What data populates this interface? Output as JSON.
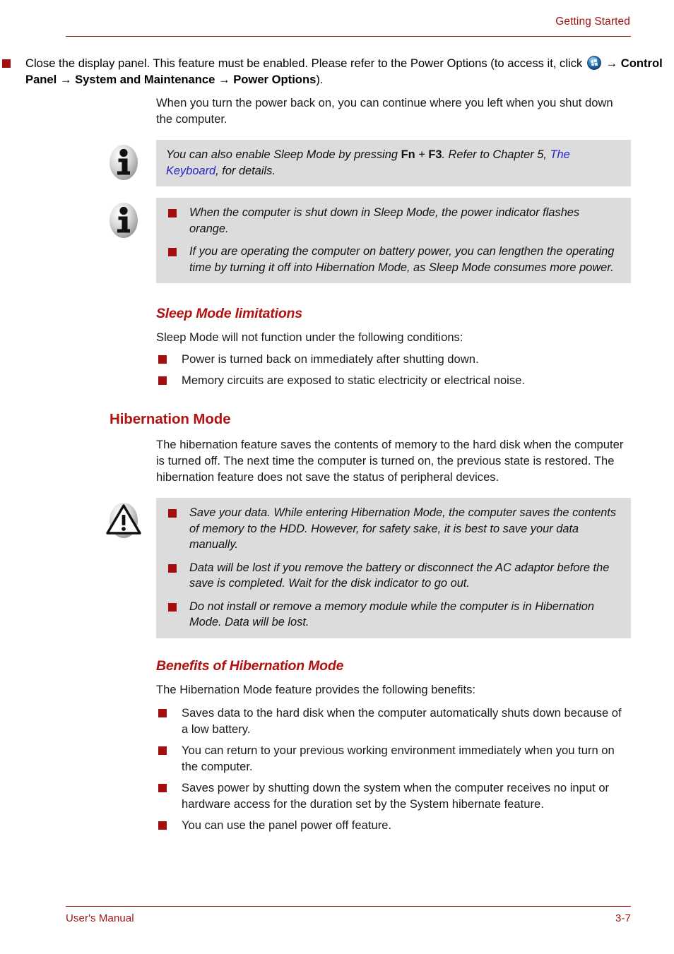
{
  "header": {
    "title": "Getting Started"
  },
  "footer": {
    "left": "User's Manual",
    "page": "3-7"
  },
  "colors": {
    "accent_red": "#9e1212",
    "heading_red": "#b01111",
    "bullet_red": "#a50e0e",
    "note_background": "#dcdcdc",
    "link_blue": "#2222cc"
  },
  "content": {
    "intro_bullet": {
      "part1": "Close the display panel. This feature must be enabled. Please refer to the Power Options (to access it, click ",
      "icon": "windows-start-orb-icon",
      "arrow1": " → ",
      "bold1": "Control Panel",
      "arrow2": " → ",
      "bold2": "System and Maintenance",
      "arrow3": " → ",
      "bold3": "Power Options",
      "part_end": ")."
    },
    "intro_paragraph": "When you turn the power back on, you can continue where you left when you shut down the computer.",
    "note1": {
      "icon": "info-icon",
      "text_a": "You can also enable Sleep Mode by pressing ",
      "key1": "Fn",
      "plus": " + ",
      "key2": "F3",
      "text_b": ". Refer to Chapter 5, ",
      "link": "The Keyboard",
      "text_c": ", for details."
    },
    "note2": {
      "icon": "info-icon",
      "bullets": [
        "When the computer is shut down in Sleep Mode, the power indicator flashes orange.",
        "If you are operating the computer on battery power, you can lengthen the operating time by turning it off into Hibernation Mode, as Sleep Mode consumes more power."
      ]
    },
    "sleep_limitations": {
      "heading": "Sleep Mode limitations",
      "intro": "Sleep Mode will not function under the following conditions:",
      "bullets": [
        "Power is turned back on immediately after shutting down.",
        "Memory circuits are exposed to static electricity or electrical noise."
      ]
    },
    "hibernation": {
      "heading": "Hibernation Mode",
      "paragraph": "The hibernation feature saves the contents of memory to the hard disk when the computer is turned off. The next time the computer is turned on, the previous state is restored. The hibernation feature does not save the status of peripheral devices."
    },
    "caution": {
      "icon": "caution-triangle-icon",
      "bullets": [
        "Save your data. While entering Hibernation Mode, the computer saves the contents of memory to the HDD. However, for safety sake, it is best to save your data manually.",
        "Data will be lost if you remove the battery or disconnect the AC adaptor before the save is completed. Wait for the disk indicator to go out.",
        "Do not install or remove a memory module while the computer is in Hibernation Mode. Data will be lost."
      ]
    },
    "benefits": {
      "heading": "Benefits of Hibernation Mode",
      "intro": "The Hibernation Mode feature provides the following benefits:",
      "bullets": [
        "Saves data to the hard disk when the computer automatically shuts down because of a low battery.",
        "You can return to your previous working environment immediately when you turn on the computer.",
        "Saves power by shutting down the system when the computer receives no input or hardware access for the duration set by the System hibernate feature.",
        "You can use the panel power off feature."
      ]
    }
  }
}
